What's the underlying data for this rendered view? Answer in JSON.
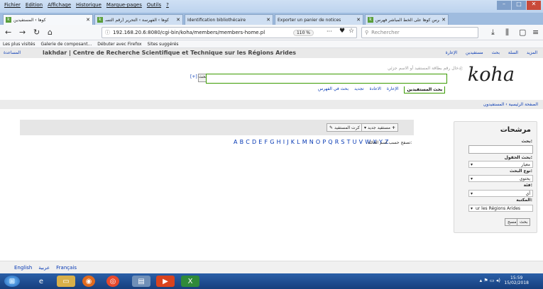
{
  "window": {
    "menu": [
      "Fichier",
      "Edition",
      "Affichage",
      "Historique",
      "Marque-pages",
      "Outils",
      "?"
    ],
    "controls": [
      "–",
      "□",
      "✕"
    ]
  },
  "tabs": [
    {
      "label": "كوها › المستفيدين",
      "active": true
    },
    {
      "label": "كوها › الفهرسة › التحرير (رقم التسـ",
      "active": false
    },
    {
      "label": "Identification bibliothécaire",
      "active": false
    },
    {
      "label": "Exporter un panier de notices",
      "active": false
    },
    {
      "label": "فهرس كوها على الخط المباشر فهرس",
      "active": false
    }
  ],
  "nav": {
    "url": "192.168.20.6:8080/cgi-bin/koha/members/members-home.pl",
    "zoom": "110 %",
    "search_placeholder": "Rechercher",
    "page_actions": "···"
  },
  "bookmarks": [
    "Les plus visités",
    "Galerie de composant...",
    "Débuter avec Firefox",
    "Sites suggérés"
  ],
  "koha": {
    "library": "lakhdar | Centre de Recherche Scientifique et Technique sur les Régions Arides",
    "help": "المساعدة",
    "topnav": [
      "الإعارة",
      "مستفيدين",
      "بحث",
      "السلة",
      "المزيد"
    ],
    "logo": "koha",
    "search_hint": "إدخال رقم بطاقة المستفيد أو الاسم جزئي:",
    "plus": "[+]",
    "go": "بحث",
    "search_tabs": [
      "بحث المستفيدين",
      "الإعارة",
      "الاعادة",
      "تجديد",
      "بحث في الفهرس"
    ],
    "breadcrumb": "الصفحة الرئيسية › المستفيدون"
  },
  "toolbar": {
    "new_patron": "مستفيد جديد",
    "patron_card": "كرت المستفيد"
  },
  "alphabet": "A B C D E F G H I J K L M N O P Q R S T U V W X Y Z",
  "browse_label": "تصفح حسب اسم العائلة:",
  "filter": {
    "title": "مرشحات",
    "search_label": "بحث:",
    "field_label": "بحث الحقول:",
    "field_value": "معيار",
    "type_label": "نوع البحث:",
    "type_value": "يحتوي",
    "category_label": "فئة:",
    "category_value": "أي",
    "library_label": "المكتبة:",
    "library_value": "ur les Régions Arides",
    "search_button": "بحث",
    "clear_button": "مسح"
  },
  "languages": [
    "English",
    "عربية",
    "Français"
  ],
  "taskbar": {
    "time": "15:59",
    "date": "15/02/2018"
  }
}
